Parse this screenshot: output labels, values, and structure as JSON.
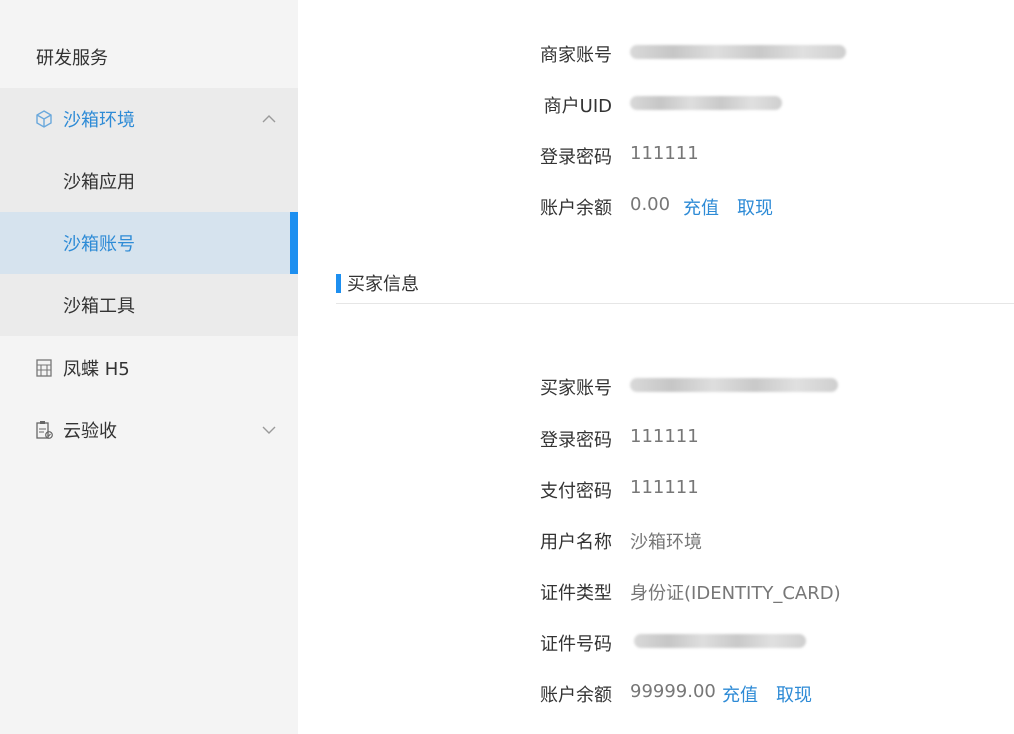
{
  "sidebar": {
    "title": "研发服务",
    "items": [
      {
        "label": "沙箱环境",
        "icon": "cube-icon",
        "expanded": true
      },
      {
        "label": "沙箱应用"
      },
      {
        "label": "沙箱账号",
        "active": true
      },
      {
        "label": "沙箱工具"
      },
      {
        "label": "凤蝶 H5",
        "icon": "building-icon"
      },
      {
        "label": "云验收",
        "icon": "clipboard-check-icon",
        "expanded": false
      }
    ]
  },
  "merchant": {
    "account_label": "商家账号",
    "uid_label": "商户UID",
    "password_label": "登录密码",
    "password_value": "111111",
    "balance_label": "账户余额",
    "balance_value": "0.00",
    "recharge": "充值",
    "withdraw": "取现"
  },
  "buyer": {
    "section_title": "买家信息",
    "account_label": "买家账号",
    "login_password_label": "登录密码",
    "login_password_value": "111111",
    "pay_password_label": "支付密码",
    "pay_password_value": "111111",
    "user_name_label": "用户名称",
    "user_name_value": "沙箱环境",
    "id_type_label": "证件类型",
    "id_type_value": "身份证(IDENTITY_CARD)",
    "id_number_label": "证件号码",
    "balance_label": "账户余额",
    "balance_value": "99999.00",
    "recharge": "充值",
    "withdraw": "取现"
  },
  "colors": {
    "accent": "#2e8bd6",
    "active_bar": "#1d8ff0",
    "sidebar_bg": "#f4f4f4",
    "active_bg": "#d6e3ee"
  }
}
